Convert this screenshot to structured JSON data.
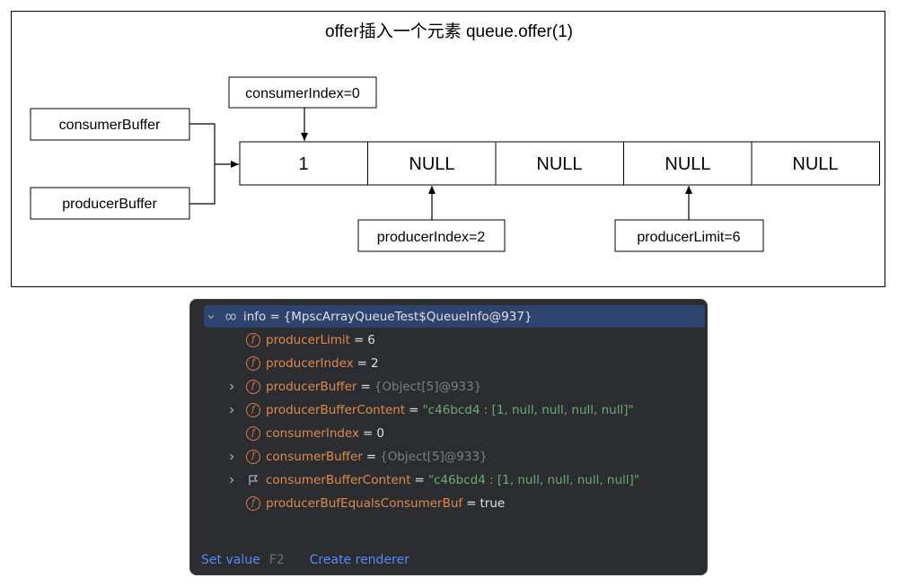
{
  "diagram": {
    "title": "offer插入一个元素 queue.offer(1)",
    "cells": [
      "1",
      "NULL",
      "NULL",
      "NULL",
      "NULL"
    ],
    "labels": {
      "consumer_index": "consumerIndex=0",
      "consumer_buffer": "consumerBuffer",
      "producer_buffer": "producerBuffer",
      "producer_index": "producerIndex=2",
      "producer_limit": "producerLimit=6"
    }
  },
  "debugger": {
    "root": {
      "name": "info",
      "value": "{MpscArrayQueueTest$QueueInfo@937}"
    },
    "fields": [
      {
        "name": "producerLimit",
        "value": "6",
        "value_kind": "num",
        "expandable": false,
        "icon": "field-icon"
      },
      {
        "name": "producerIndex",
        "value": "2",
        "value_kind": "num",
        "expandable": false,
        "icon": "field-icon"
      },
      {
        "name": "producerBuffer",
        "value": "{Object[5]@933}",
        "value_kind": "ref",
        "expandable": true,
        "icon": "field-icon"
      },
      {
        "name": "producerBufferContent",
        "value": "\"c46bcd4 : [1, null, null, null, null]\"",
        "value_kind": "str",
        "expandable": true,
        "icon": "field-icon"
      },
      {
        "name": "consumerIndex",
        "value": "0",
        "value_kind": "num",
        "expandable": false,
        "icon": "field-icon"
      },
      {
        "name": "consumerBuffer",
        "value": "{Object[5]@933}",
        "value_kind": "ref",
        "expandable": true,
        "icon": "field-icon"
      },
      {
        "name": "consumerBufferContent",
        "value": "\"c46bcd4 : [1, null, null, null, null]\"",
        "value_kind": "str",
        "expandable": true,
        "icon": "flag-icon"
      },
      {
        "name": "producerBufEqualsConsumerBuf",
        "value": "true",
        "value_kind": "kw",
        "expandable": false,
        "icon": "field-icon"
      }
    ],
    "eq_sign": "=",
    "field_icon_glyph": "f",
    "footer": {
      "set_value": "Set value",
      "set_value_shortcut": "F2",
      "create_renderer": "Create renderer"
    }
  },
  "colors": {
    "panel_bg": "#2b2d30",
    "selection": "#2e436e",
    "field_name": "#e0894f",
    "string_value": "#6aab73",
    "reference_value": "#7a7e85",
    "link": "#548af7"
  }
}
